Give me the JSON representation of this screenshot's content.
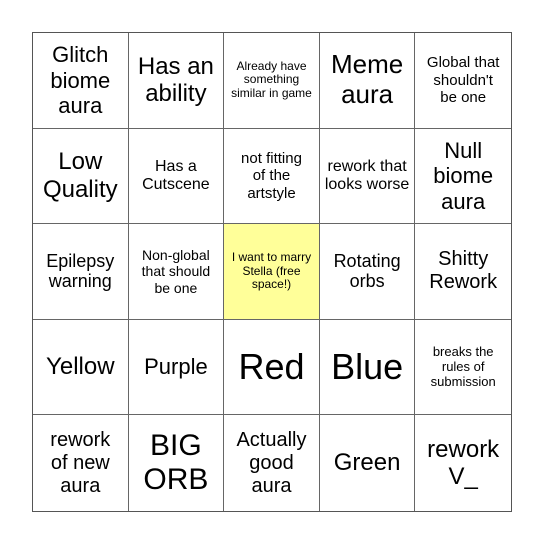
{
  "board": {
    "cells": [
      {
        "text": "Glitch biome aura",
        "free": false
      },
      {
        "text": "Has an ability",
        "free": false
      },
      {
        "text": "Already have something similar in game",
        "free": false
      },
      {
        "text": "Meme aura",
        "free": false
      },
      {
        "text": "Global that shouldn't be one",
        "free": false
      },
      {
        "text": "Low Quality",
        "free": false
      },
      {
        "text": "Has a Cutscene",
        "free": false
      },
      {
        "text": "not fitting of the artstyle",
        "free": false
      },
      {
        "text": "rework that looks worse",
        "free": false
      },
      {
        "text": "Null biome aura",
        "free": false
      },
      {
        "text": "Epilepsy warning",
        "free": false
      },
      {
        "text": "Non-global that should be one",
        "free": false
      },
      {
        "text": "I want to marry Stella (free space!)",
        "free": true
      },
      {
        "text": "Rotating orbs",
        "free": false
      },
      {
        "text": "Shitty Rework",
        "free": false
      },
      {
        "text": "Yellow",
        "free": false
      },
      {
        "text": "Purple",
        "free": false
      },
      {
        "text": "Red",
        "free": false
      },
      {
        "text": "Blue",
        "free": false
      },
      {
        "text": "breaks the rules of submission",
        "free": false
      },
      {
        "text": "rework of new aura",
        "free": false
      },
      {
        "text": "BIG ORB",
        "free": false
      },
      {
        "text": "Actually good aura",
        "free": false
      },
      {
        "text": "Green",
        "free": false
      },
      {
        "text": "rework V_",
        "free": false
      }
    ],
    "free_space_color": "#ffff99"
  }
}
